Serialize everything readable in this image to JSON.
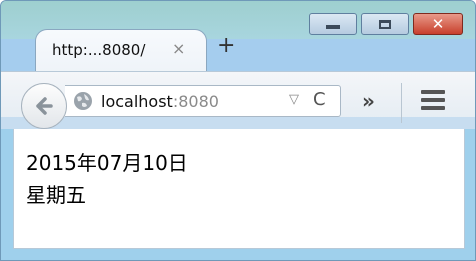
{
  "window": {
    "tab": {
      "title": "http:...8080/",
      "close_glyph": "×"
    },
    "new_tab_glyph": "+",
    "caption": {
      "minimize": "minimize-icon",
      "maximize": "maximize-icon",
      "close_glyph": "✕"
    }
  },
  "toolbar": {
    "url_host": "localhost",
    "url_port": ":8080",
    "dropdown_glyph": "▽",
    "reload_glyph": "C",
    "overflow_glyph": "»"
  },
  "content": {
    "date_line": "2015年07月10日",
    "weekday_line": "星期五"
  },
  "colors": {
    "titlebar": "#9ecfcf",
    "frame": "#9fd0ec",
    "close_button": "#c8402c"
  }
}
